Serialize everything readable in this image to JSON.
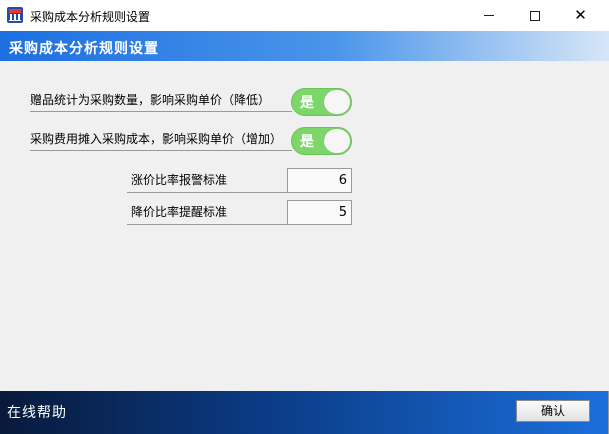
{
  "window": {
    "title": "采购成本分析规则设置",
    "close_glyph": "✕"
  },
  "banner": {
    "title": "采购成本分析规则设置"
  },
  "options": [
    {
      "label": "赠品统计为采购数量，影响采购单价（降低）",
      "toggle_text": "是",
      "on": true
    },
    {
      "label": "采购费用摊入采购成本，影响采购单价（增加）",
      "toggle_text": "是",
      "on": true
    }
  ],
  "thresholds": [
    {
      "label": "涨价比率报警标准",
      "value": "6"
    },
    {
      "label": "降价比率提醒标准",
      "value": "5"
    }
  ],
  "footer": {
    "help_label": "在线帮助",
    "ok_label": "确认"
  },
  "colors": {
    "toggle_on": "#7dd66a",
    "banner_start": "#1d6fe0",
    "footer_dark": "#081a3a"
  }
}
